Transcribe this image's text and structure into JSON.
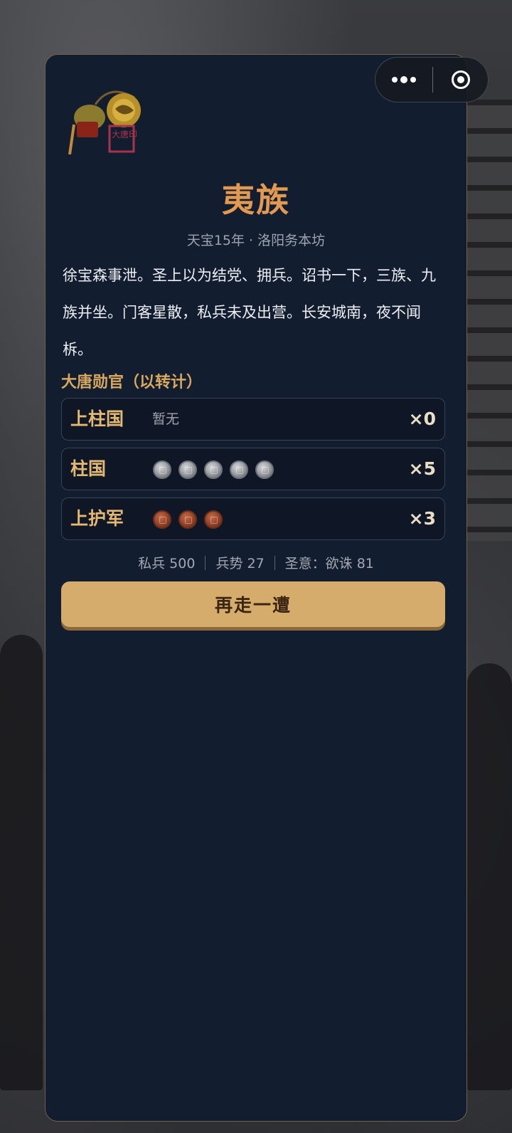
{
  "capsule": {
    "more_icon": "more-dots-icon",
    "close_icon": "target-close-icon"
  },
  "emblem": {
    "seal_text": "大唐印"
  },
  "result": {
    "title": "夷族",
    "subtitle": "天宝15年 · 洛阳务本坊",
    "narrative": "徐宝森事泄。圣上以为结党、拥兵。诏书一下，三族、九族并坐。门客星散，私兵未及出营。长安城南，夜不闻柝。"
  },
  "honors": {
    "section_title": "大唐勋官（以转计）",
    "ranks": [
      {
        "name": "上柱国",
        "none_text": "暂无",
        "medal_type": "none",
        "medal_count": 0,
        "count_text": "×0"
      },
      {
        "name": "柱国",
        "none_text": "",
        "medal_type": "silver",
        "medal_count": 5,
        "count_text": "×5"
      },
      {
        "name": "上护军",
        "none_text": "",
        "medal_type": "bronze",
        "medal_count": 3,
        "count_text": "×3"
      }
    ]
  },
  "stats": {
    "private_army": "私兵 500",
    "military_power": "兵势 27",
    "imperial_will": "圣意：欲诛 81"
  },
  "actions": {
    "again_label": "再走一遭"
  },
  "colors": {
    "card_bg": "#131d30",
    "title": "#e29a52",
    "accent_gold": "#d5ac6b",
    "rank_gold": "#e3b873"
  }
}
